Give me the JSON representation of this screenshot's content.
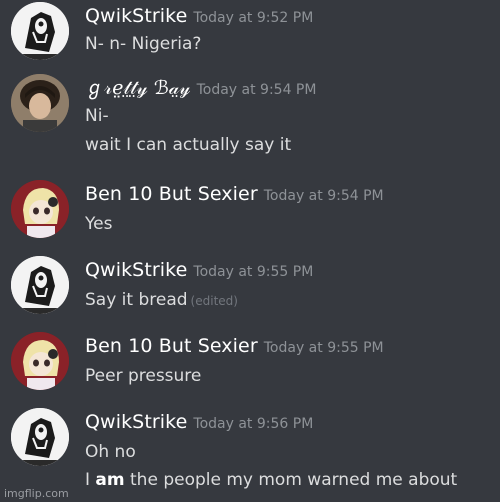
{
  "messages": [
    {
      "username": "QwikStrike",
      "timestamp": "Today at 9:52 PM",
      "lines": [
        "N- n- Nigeria?"
      ],
      "avatar": "skull-mask-avatar"
    },
    {
      "username": "ℊ𝓇ℯ𝓉𝓉𝓎 ℬ𝒶𝓎",
      "username_display": "ℊ𝓇ℯ̤𝓉̤𝓉̤𝓎 ℬ𝒶̤𝓎",
      "timestamp": "Today at 9:54 PM",
      "lines": [
        "Ni-",
        "wait I can actually say it"
      ],
      "avatar": "curly-hair-person-avatar"
    },
    {
      "username": "Ben 10 But Sexier",
      "timestamp": "Today at 9:54 PM",
      "lines": [
        "Yes"
      ],
      "avatar": "blonde-cartoon-girl-avatar"
    },
    {
      "username": "QwikStrike",
      "timestamp": "Today at 9:55 PM",
      "lines": [
        "Say it bread"
      ],
      "edited": "(edited)",
      "avatar": "skull-mask-avatar"
    },
    {
      "username": "Ben 10 But Sexier",
      "timestamp": "Today at 9:55 PM",
      "lines": [
        "Peer pressure"
      ],
      "avatar": "blonde-cartoon-girl-avatar"
    },
    {
      "username": "QwikStrike",
      "timestamp": "Today at 9:56 PM",
      "lines": [
        "Oh no"
      ],
      "rich_line": {
        "prefix": "I ",
        "bold": "am",
        "suffix": " the people my mom warned me about"
      },
      "avatar": "skull-mask-avatar"
    }
  ],
  "watermark": "imgflip.com",
  "colors": {
    "background": "#36393f",
    "username": "#ffffff",
    "timestamp": "#8e9297",
    "text": "#dcddde"
  }
}
